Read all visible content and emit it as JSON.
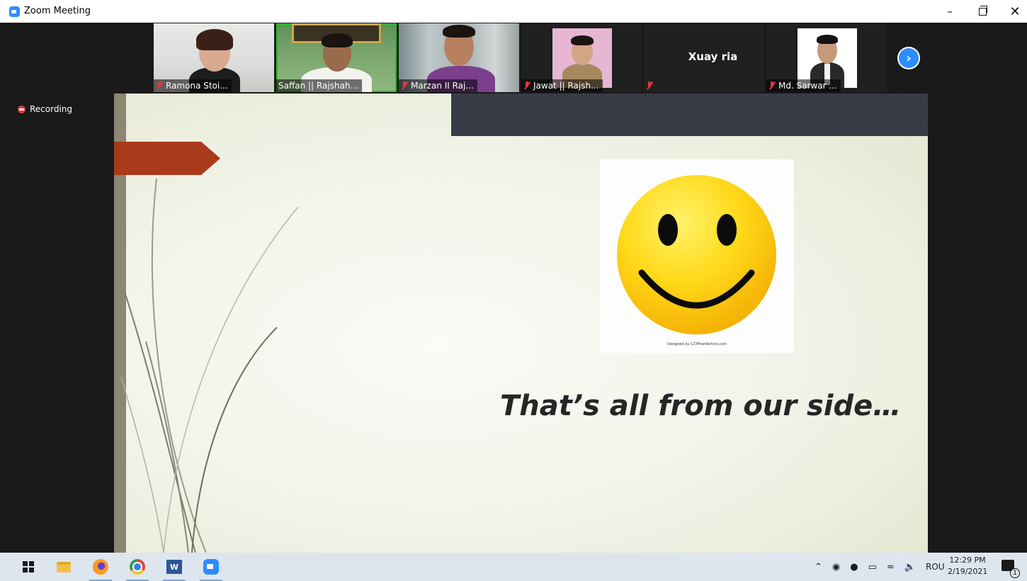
{
  "window": {
    "title": "Zoom Meeting"
  },
  "participants": [
    {
      "name": "Ramona Stoi...",
      "muted": true
    },
    {
      "name": "Saffan || Rajshah...",
      "muted": false,
      "active_speaker": true
    },
    {
      "name": "Marzan II Raj...",
      "muted": true
    },
    {
      "name": "Jawat || Rajsh...",
      "muted": true
    },
    {
      "name": "Xuay ria",
      "label": "",
      "muted": true,
      "video_off": true
    },
    {
      "name": "Md. Sarwar ...",
      "muted": true
    }
  ],
  "recording": {
    "label": "Recording"
  },
  "slide": {
    "text": "That’s all from our side…",
    "image_credit": "Designed by 123FreeVectors.com"
  },
  "taskbar": {
    "apps": [
      "start-icon",
      "file-explorer-icon",
      "firefox-icon",
      "chrome-icon",
      "word-icon",
      "zoom-icon"
    ],
    "language": "ROU",
    "time": "12:29 PM",
    "date": "2/19/2021",
    "notification_count": "1"
  },
  "colors": {
    "zoom_blue": "#2d8cff",
    "mute_red": "#e0393e",
    "active_green": "#22c022",
    "slide_accent": "#a93a1b"
  }
}
